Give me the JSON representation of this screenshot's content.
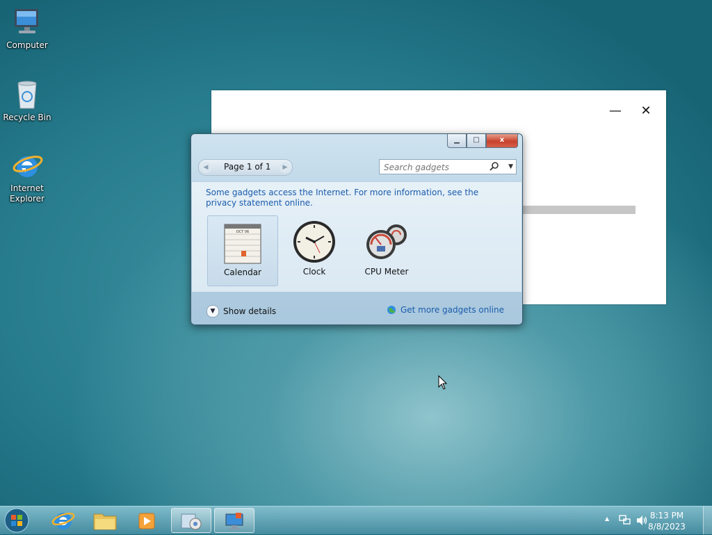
{
  "desktop": {
    "icons": [
      {
        "label": "Computer"
      },
      {
        "label": "Recycle Bin"
      },
      {
        "label": "Internet Explorer"
      }
    ]
  },
  "background_window": {
    "minimize": "—",
    "close": "✕"
  },
  "gadgets_window": {
    "caption": {
      "minimize": "▁",
      "maximize": "□",
      "close": "x"
    },
    "pager": {
      "label": "Page 1 of 1",
      "prev": "◀",
      "next": "▶"
    },
    "search": {
      "placeholder": "Search gadgets",
      "dropdown": "▼"
    },
    "notice": "Some gadgets access the Internet.  For more information, see the privacy statement online.",
    "gadgets": [
      {
        "name": "Calendar",
        "selected": true,
        "calendar_month": "OCT 06"
      },
      {
        "name": "Clock",
        "selected": false
      },
      {
        "name": "CPU Meter",
        "selected": false
      }
    ],
    "show_details": "Show details",
    "get_more": "Get more gadgets online"
  },
  "taskbar": {
    "clock_time": "8:13 PM",
    "clock_date": "8/8/2023",
    "tray_up": "▲"
  }
}
